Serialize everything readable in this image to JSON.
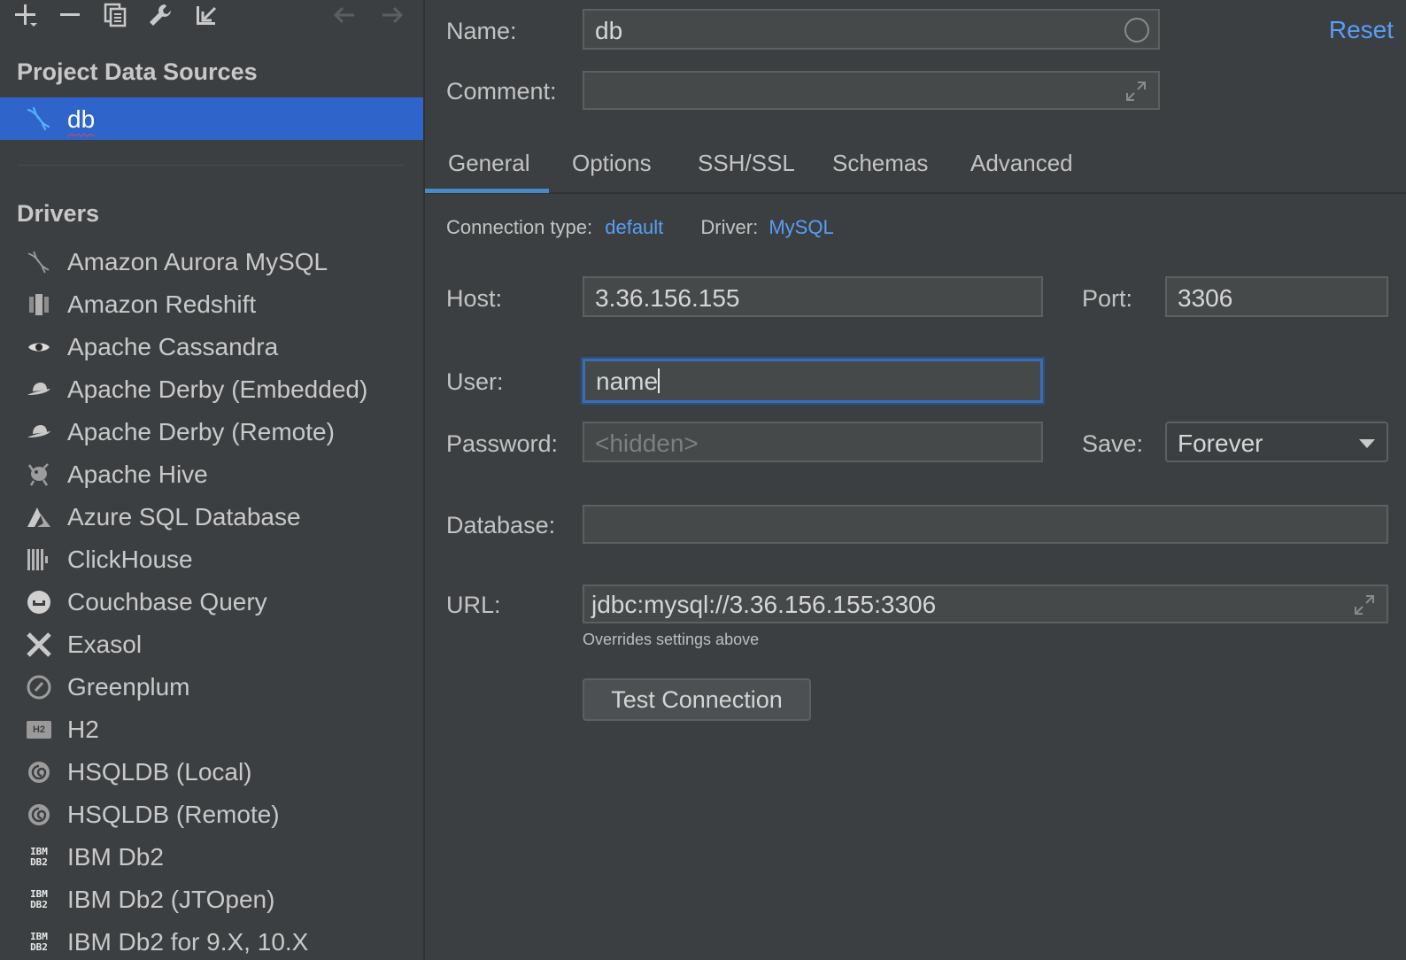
{
  "toolbar": {
    "icons": [
      "add-icon",
      "remove-icon",
      "duplicate-icon",
      "wrench-icon",
      "import-icon",
      "back-icon",
      "forward-icon"
    ]
  },
  "project_data_sources": {
    "title": "Project Data Sources",
    "items": [
      {
        "label": "db",
        "icon": "mysql-dolphin-icon",
        "selected": true
      }
    ]
  },
  "drivers": {
    "title": "Drivers",
    "items": [
      {
        "label": "Amazon Aurora MySQL",
        "icon": "aurora-mysql-icon"
      },
      {
        "label": "Amazon Redshift",
        "icon": "redshift-icon"
      },
      {
        "label": "Apache Cassandra",
        "icon": "cassandra-eye-icon"
      },
      {
        "label": "Apache Derby (Embedded)",
        "icon": "derby-hat-icon"
      },
      {
        "label": "Apache Derby (Remote)",
        "icon": "derby-hat-icon"
      },
      {
        "label": "Apache Hive",
        "icon": "hive-bee-icon"
      },
      {
        "label": "Azure SQL Database",
        "icon": "azure-icon"
      },
      {
        "label": "ClickHouse",
        "icon": "clickhouse-icon"
      },
      {
        "label": "Couchbase Query",
        "icon": "couchbase-icon"
      },
      {
        "label": "Exasol",
        "icon": "exasol-x-icon"
      },
      {
        "label": "Greenplum",
        "icon": "greenplum-icon"
      },
      {
        "label": "H2",
        "icon": "h2-icon"
      },
      {
        "label": "HSQLDB (Local)",
        "icon": "hsqldb-icon"
      },
      {
        "label": "HSQLDB (Remote)",
        "icon": "hsqldb-icon"
      },
      {
        "label": "IBM Db2",
        "icon": "ibm-db2-icon"
      },
      {
        "label": "IBM Db2 (JTOpen)",
        "icon": "ibm-db2-icon"
      },
      {
        "label": "IBM Db2 for 9.X, 10.X",
        "icon": "ibm-db2-icon"
      }
    ],
    "h2_badge": "H2",
    "ibm_badge_top": "IBM",
    "ibm_badge_bottom": "DB2"
  },
  "form": {
    "name_label": "Name:",
    "name_value": "db",
    "reset_label": "Reset",
    "comment_label": "Comment:",
    "comment_value": "",
    "tabs": [
      "General",
      "Options",
      "SSH/SSL",
      "Schemas",
      "Advanced"
    ],
    "active_tab": "General",
    "connection_type_label": "Connection type:",
    "connection_type_value": "default",
    "driver_label": "Driver:",
    "driver_value": "MySQL",
    "host_label": "Host:",
    "host_value": "3.36.156.155",
    "port_label": "Port:",
    "port_value": "3306",
    "user_label": "User:",
    "user_value": "name",
    "password_label": "Password:",
    "password_placeholder": "<hidden>",
    "save_label": "Save:",
    "save_value": "Forever",
    "database_label": "Database:",
    "database_value": "",
    "url_label": "URL:",
    "url_value": "jdbc:mysql://3.36.156.155:3306",
    "url_hint": "Overrides settings above",
    "test_button": "Test Connection"
  },
  "colors": {
    "background": "#3c3f41",
    "selection": "#2f65ca",
    "link": "#589df6",
    "focus_border": "#3d6db0"
  }
}
